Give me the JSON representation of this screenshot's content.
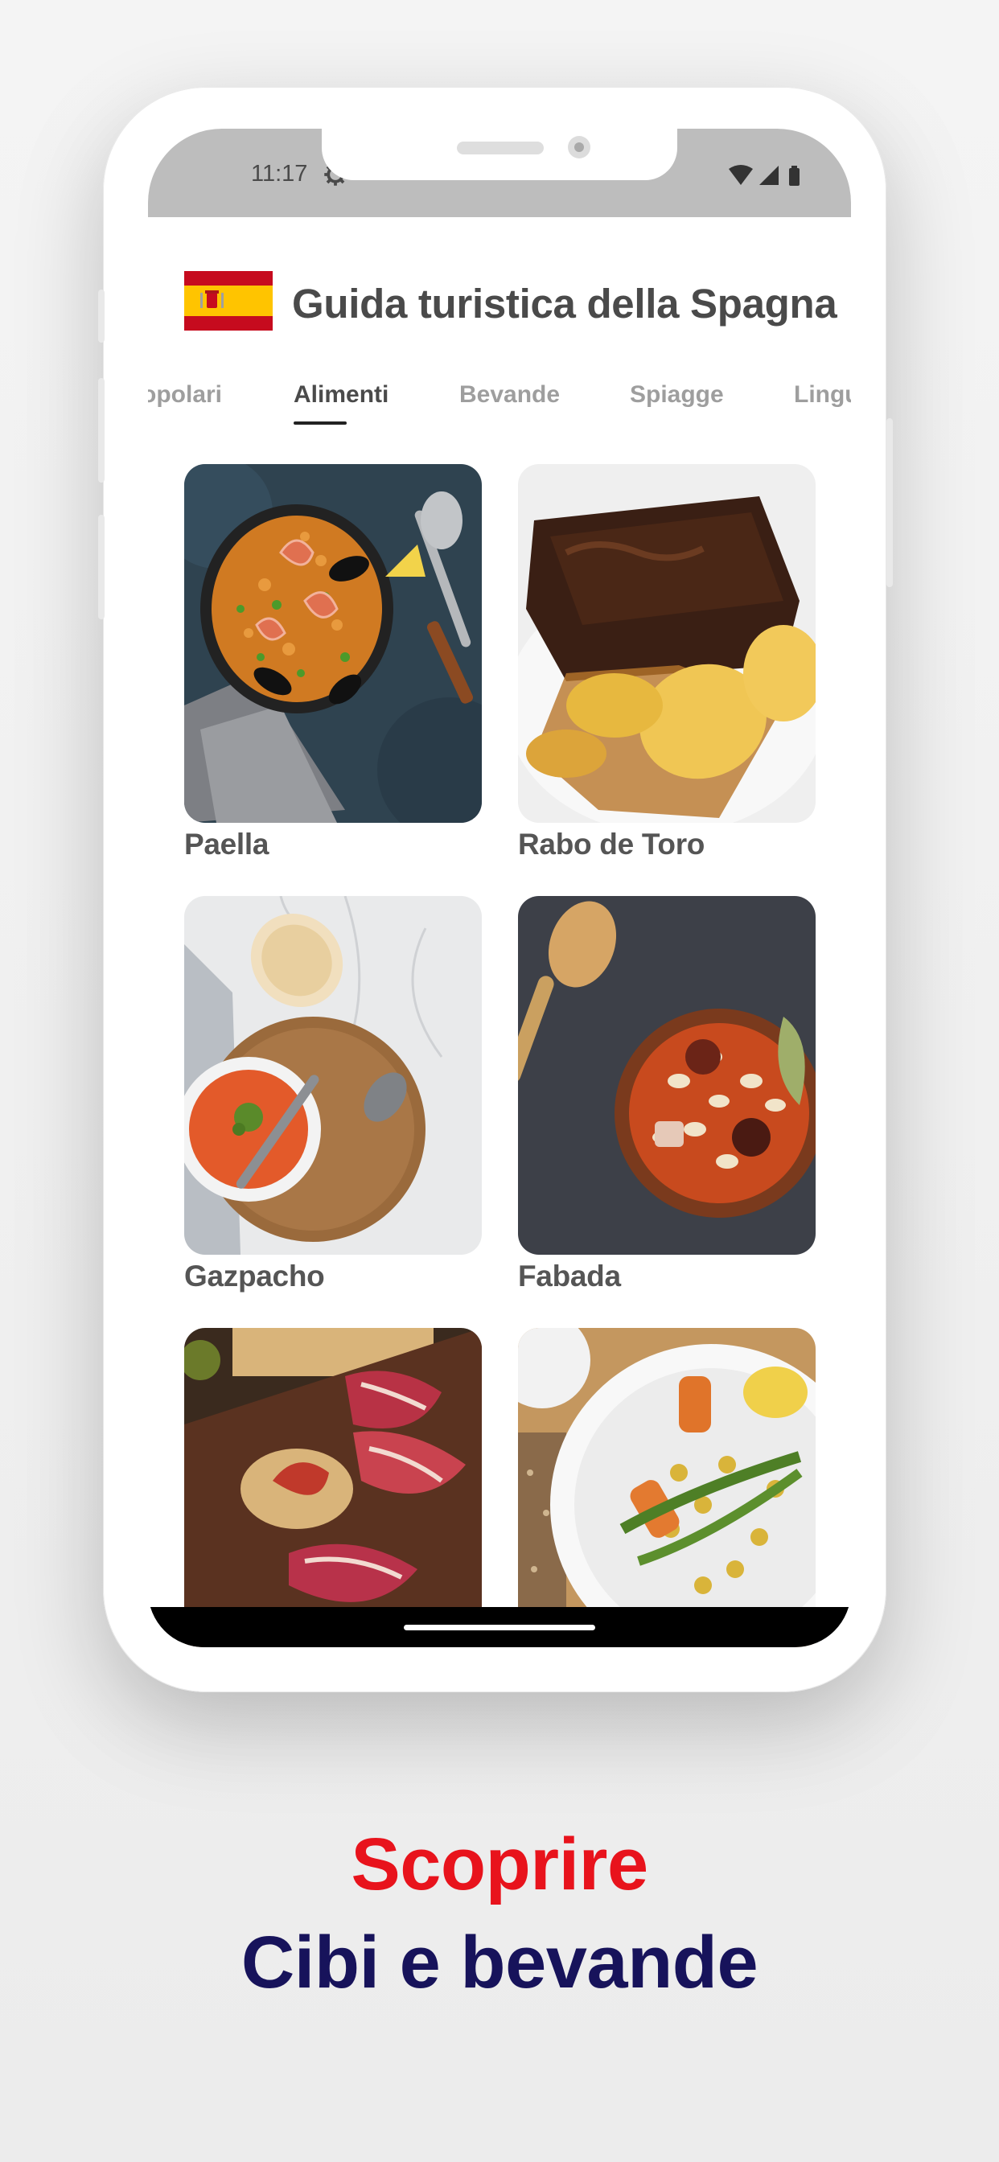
{
  "status": {
    "time": "11:17"
  },
  "header": {
    "title": "Guida turistica della Spagna"
  },
  "tabs": [
    {
      "label": "Popolari"
    },
    {
      "label": "Alimenti",
      "active": true
    },
    {
      "label": "Bevande"
    },
    {
      "label": "Spiagge"
    },
    {
      "label": "Lingua"
    }
  ],
  "foods": [
    {
      "label": "Paella"
    },
    {
      "label": "Rabo de Toro"
    },
    {
      "label": "Gazpacho"
    },
    {
      "label": "Fabada"
    },
    {
      "label": ""
    },
    {
      "label": ""
    }
  ],
  "promo": {
    "line1": "Scoprire",
    "line2": "Cibi e bevande"
  },
  "colors": {
    "accent_red": "#e8131c",
    "accent_navy": "#17135b",
    "statusbar": "#bdbdbd"
  }
}
